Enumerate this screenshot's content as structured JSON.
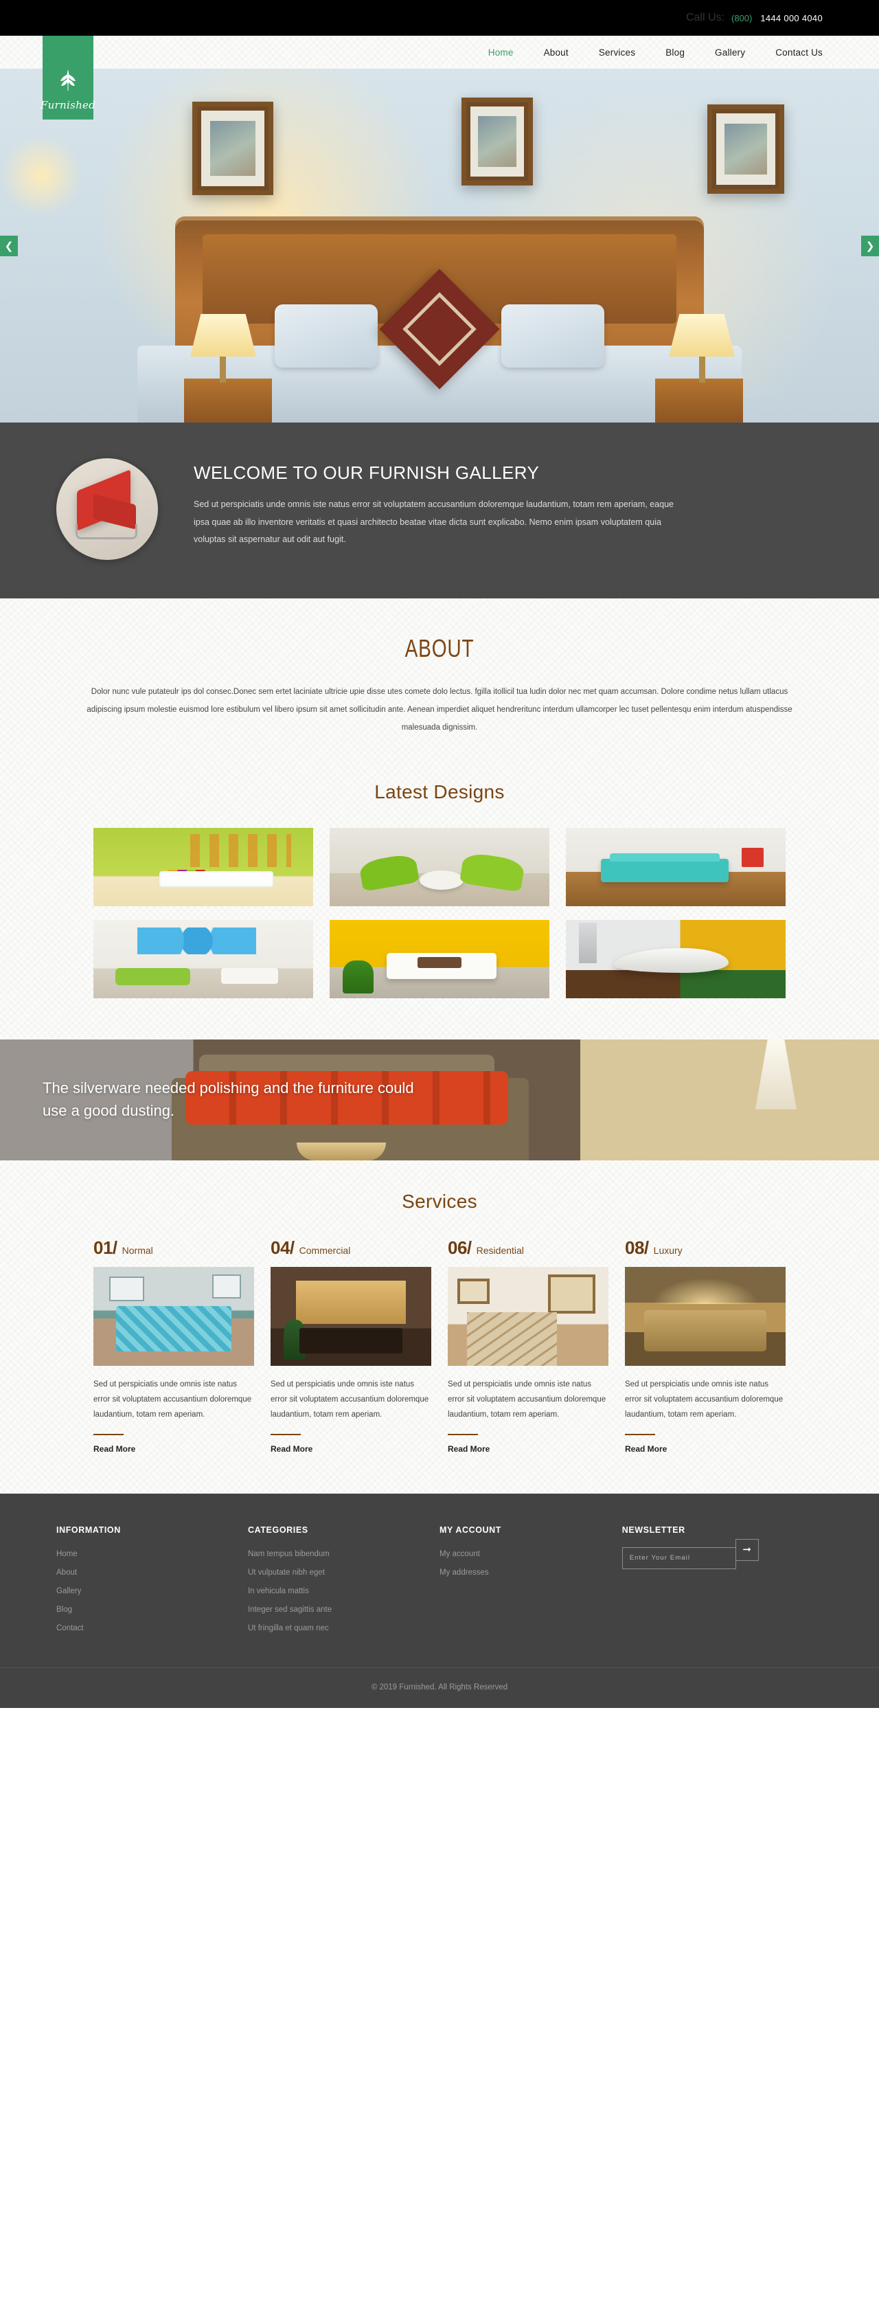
{
  "brand": {
    "name": "Furnished",
    "accent_green": "#3aa06a",
    "accent_brown": "#7a4512",
    "leaf_icon": "leaf-icon"
  },
  "topbar": {
    "call_label": "Call Us:",
    "area_code": "(800)",
    "phone": "1444 000 4040"
  },
  "nav": {
    "items": [
      {
        "label": "Home",
        "active": true
      },
      {
        "label": "About",
        "active": false
      },
      {
        "label": "Services",
        "active": false
      },
      {
        "label": "Blog",
        "active": false
      },
      {
        "label": "Gallery",
        "active": false
      },
      {
        "label": "Contact Us",
        "active": false
      }
    ]
  },
  "hero": {
    "prev_icon": "chevron-left-icon",
    "next_icon": "chevron-right-icon",
    "image_alt": "bedroom-with-wooden-headboard"
  },
  "welcome": {
    "title": "WELCOME TO OUR FURNISH GALLERY",
    "text": "Sed ut perspiciatis unde omnis iste natus error sit voluptatem accusantium doloremque laudantium, totam rem aperiam, eaque ipsa quae ab illo inventore veritatis et quasi architecto beatae vitae dicta sunt explicabo. Nemo enim ipsam voluptatem quia voluptas sit aspernatur aut odit aut fugit.",
    "image_alt": "red-lounge-chair"
  },
  "about": {
    "title": "ABOUT",
    "text": "Dolor nunc vule putateulr ips dol consec.Donec sem ertet laciniate ultricie upie disse utes comete dolo lectus. fgilla itollicil tua ludin dolor nec met quam accumsan. Dolore condime netus lullam utlacus adipiscing ipsum molestie euismod lore estibulum vel libero ipsum sit amet sollicitudin ante. Aenean imperdiet aliquet hendreritunc interdum ullamcorper lec tuset pellentesqu enim interdum atuspendisse malesuada dignissim."
  },
  "designs": {
    "title": "Latest Designs",
    "tiles": [
      {
        "alt": "green-wall-living-room-with-colorful-cushions"
      },
      {
        "alt": "green-lounge-chairs-with-round-table"
      },
      {
        "alt": "teal-sofa-on-wooden-floor"
      },
      {
        "alt": "blue-circles-wall-with-green-armchairs"
      },
      {
        "alt": "yellow-wall-with-white-sofa"
      },
      {
        "alt": "white-curved-lounge-chair"
      }
    ]
  },
  "quote": {
    "text": "The silverware needed polishing and the furniture could use a good dusting.",
    "image_alt": "brown-sofa-with-orange-cushions"
  },
  "services": {
    "title": "Services",
    "items": [
      {
        "number": "01/",
        "name": "Normal",
        "text": "Sed ut perspiciatis unde omnis iste natus error sit voluptatem accusantium doloremque laudantium, totam rem aperiam.",
        "read_more": "Read More",
        "image_alt": "bedroom-with-patterned-bedspread"
      },
      {
        "number": "04/",
        "name": "Commercial",
        "text": "Sed ut perspiciatis unde omnis iste natus error sit voluptatem accusantium doloremque laudantium, totam rem aperiam.",
        "read_more": "Read More",
        "image_alt": "dark-office-interior"
      },
      {
        "number": "06/",
        "name": "Residential",
        "text": "Sed ut perspiciatis unde omnis iste natus error sit voluptatem accusantium doloremque laudantium, totam rem aperiam.",
        "read_more": "Read More",
        "image_alt": "staircase-with-framed-pictures"
      },
      {
        "number": "08/",
        "name": "Luxury",
        "text": "Sed ut perspiciatis unde omnis iste natus error sit voluptatem accusantium doloremque laudantium, totam rem aperiam.",
        "read_more": "Read More",
        "image_alt": "luxury-bedroom-with-gold-bedding"
      }
    ]
  },
  "footer": {
    "information": {
      "title": "INFORMATION",
      "links": [
        "Home",
        "About",
        "Gallery",
        "Blog",
        "Contact"
      ]
    },
    "categories": {
      "title": "CATEGORIES",
      "links": [
        "Nam tempus bibendum",
        "Ut vulputate nibh eget",
        "In vehicula mattis",
        "Integer sed sagittis ante",
        "Ut fringilla et quam nec"
      ]
    },
    "account": {
      "title": "MY ACCOUNT",
      "links": [
        "My account",
        "My addresses"
      ]
    },
    "newsletter": {
      "title": "NEWSLETTER",
      "placeholder": "Enter Your Email",
      "value": "",
      "submit_icon": "arrow-right-icon"
    },
    "copyright": "© 2019 Furnished. All Rights Reserved"
  }
}
